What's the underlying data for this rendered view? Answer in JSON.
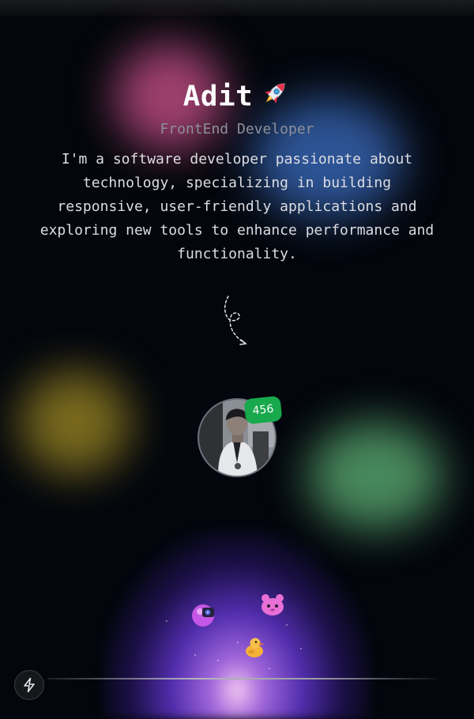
{
  "profile": {
    "name": "Adit",
    "rocket_emoji": "🚀",
    "role": "FrontEnd Developer",
    "bio": "I'm a software developer passionate about technology, specializing in building responsive, user-friendly applications and exploring new tools to enhance performance and functionality."
  },
  "avatar": {
    "badge_count": "456"
  },
  "icons": {
    "rocket": "rocket-icon",
    "scribble": "scribble-arrow-icon",
    "bolt": "lightning-bolt-icon",
    "stickers": [
      "camera-character-sticker",
      "duck-sticker",
      "pink-character-sticker"
    ]
  },
  "colors": {
    "background": "#03060c",
    "badge": "#19a94d",
    "blob_pink": "#de5896",
    "blob_blue": "#4076d2",
    "blob_yellow": "#baa028",
    "blob_green": "#60b678",
    "glow_purple": "#6e3ce6"
  }
}
